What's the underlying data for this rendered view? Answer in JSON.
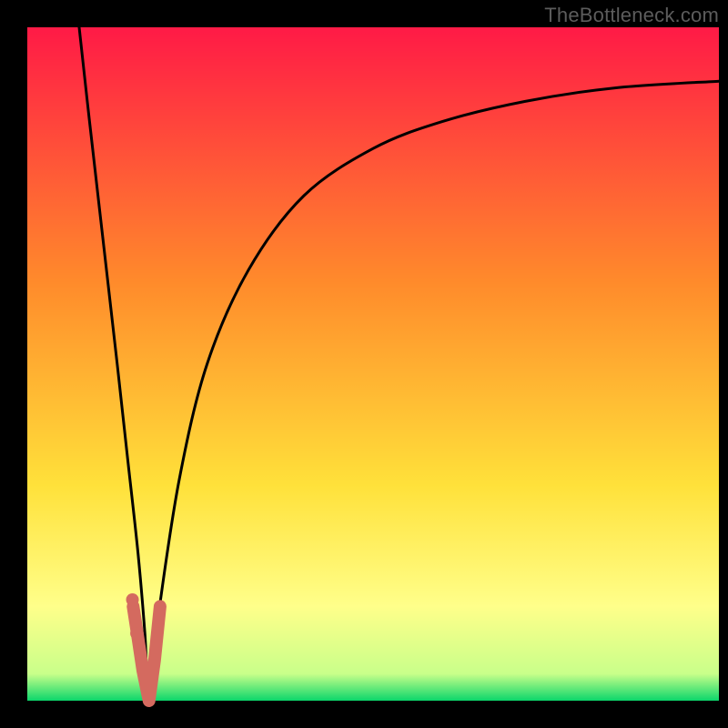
{
  "watermark": "TheBottleneck.com",
  "colors": {
    "frame": "#000000",
    "grad_top": "#ff1a46",
    "grad_mid1": "#ff8b2b",
    "grad_mid2": "#ffe13a",
    "grad_low": "#ffff8a",
    "grad_bottom": "#0bd66b",
    "curve": "#000000",
    "marker_stroke": "#d46a5f",
    "marker_fill": "#d46a5f"
  },
  "chart_data": {
    "type": "line",
    "title": "",
    "xlabel": "",
    "ylabel": "",
    "xlim": [
      0,
      100
    ],
    "ylim": [
      0,
      100
    ],
    "series": [
      {
        "name": "left-branch",
        "x": [
          7.5,
          9,
          11,
          13,
          14.5,
          16,
          17,
          17.6
        ],
        "y": [
          100,
          86,
          68,
          50,
          36,
          22,
          10,
          0
        ]
      },
      {
        "name": "right-branch",
        "x": [
          17.6,
          19,
          22,
          26,
          32,
          40,
          50,
          60,
          72,
          85,
          100
        ],
        "y": [
          0,
          13,
          33,
          50,
          64,
          75,
          82,
          86,
          89,
          91,
          92
        ]
      }
    ],
    "markers": {
      "name": "highlight-segment",
      "points": [
        {
          "x": 15.3,
          "y": 14
        },
        {
          "x": 15.9,
          "y": 10
        },
        {
          "x": 16.7,
          "y": 4.5
        },
        {
          "x": 17.6,
          "y": 0
        },
        {
          "x": 18.4,
          "y": 6
        },
        {
          "x": 19.2,
          "y": 14
        }
      ]
    }
  }
}
